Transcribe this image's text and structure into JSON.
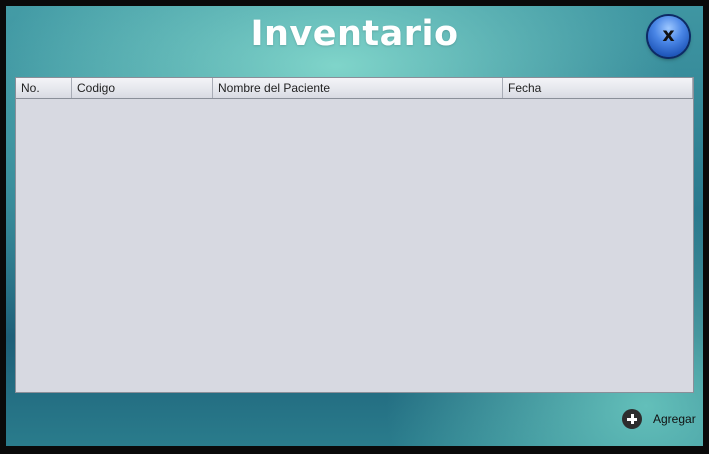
{
  "window": {
    "title": "Inventario",
    "close_label": "x"
  },
  "table": {
    "columns": [
      "No.",
      "Codigo",
      "Nombre del Paciente",
      "Fecha"
    ],
    "rows": []
  },
  "actions": {
    "add_label": "Agregar",
    "add_icon": "plus-circle-icon",
    "close_icon": "close-icon"
  },
  "colors": {
    "background_teal": "#2b7b8f",
    "table_body": "#d7d9e1",
    "close_button_blue": "#4a86e6",
    "title_text": "#ffffff"
  }
}
